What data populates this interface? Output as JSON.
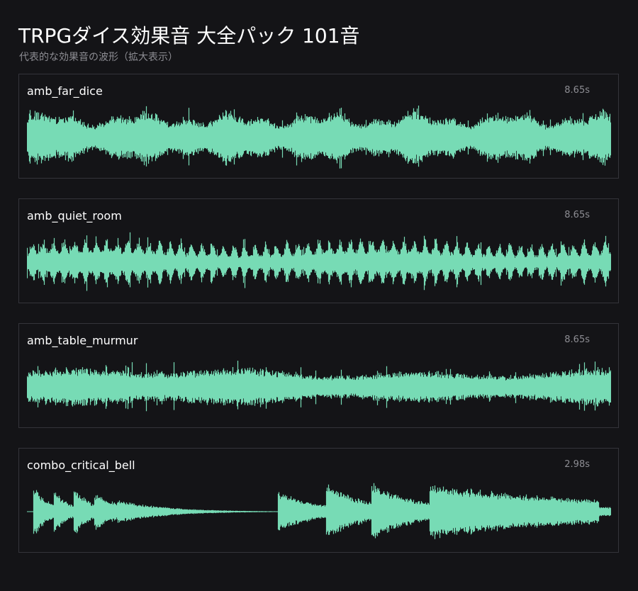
{
  "header": {
    "title": "TRPGダイス効果音 大全パック 101音",
    "subtitle": "代表的な効果音の波形（拡大表示）"
  },
  "theme": {
    "background": "#141417",
    "panel_border": "#34343a",
    "wave_color": "#77dbb5",
    "muted_text": "#8d8d93"
  },
  "panels": [
    {
      "name": "amb_far_dice",
      "duration": "8.65s",
      "wave_kind": "noise"
    },
    {
      "name": "amb_quiet_room",
      "duration": "8.65s",
      "wave_kind": "pulsed"
    },
    {
      "name": "amb_table_murmur",
      "duration": "8.65s",
      "wave_kind": "murmur"
    },
    {
      "name": "combo_critical_bell",
      "duration": "2.98s",
      "wave_kind": "bell"
    }
  ]
}
